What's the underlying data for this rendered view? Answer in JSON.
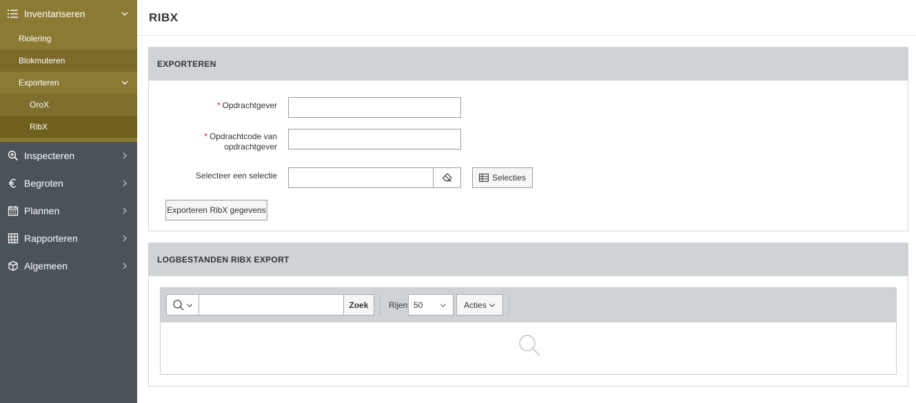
{
  "sidebar": {
    "open_section": {
      "label": "Inventariseren",
      "icon": "list-icon"
    },
    "sub_items": [
      {
        "label": "Riolering"
      },
      {
        "label": "Blokmuteren"
      },
      {
        "label": "Exporteren"
      }
    ],
    "sub_sub_items": [
      {
        "label": "OroX"
      },
      {
        "label": "RibX"
      }
    ],
    "items": [
      {
        "label": "Inspecteren",
        "icon": "zoom-in-icon"
      },
      {
        "label": "Begroten",
        "icon": "euro-icon"
      },
      {
        "label": "Plannen",
        "icon": "calendar-icon"
      },
      {
        "label": "Rapporteren",
        "icon": "table-icon"
      },
      {
        "label": "Algemeen",
        "icon": "cube-icon"
      }
    ]
  },
  "page": {
    "title": "RIBX"
  },
  "export_panel": {
    "title": "EXPORTEREN",
    "fields": {
      "opdrachtgever": {
        "label": "Opdrachtgever",
        "required_mark": "*",
        "value": ""
      },
      "opdrachtcode_line1": "Opdrachtcode van",
      "opdrachtcode_line2": "opdrachtgever",
      "opdrachtcode": {
        "required_mark": "*",
        "value": ""
      },
      "selectie": {
        "label": "Selecteer een selectie",
        "value": ""
      }
    },
    "selecties_button": "Selecties",
    "export_button": "Exporteren RibX gegevens"
  },
  "log_panel": {
    "title": "LOGBESTANDEN RIBX EXPORT",
    "search_button": "Zoek",
    "search_value": "",
    "rows_label": "Rijen",
    "rows_value": "50",
    "acties_label": "Acties"
  }
}
